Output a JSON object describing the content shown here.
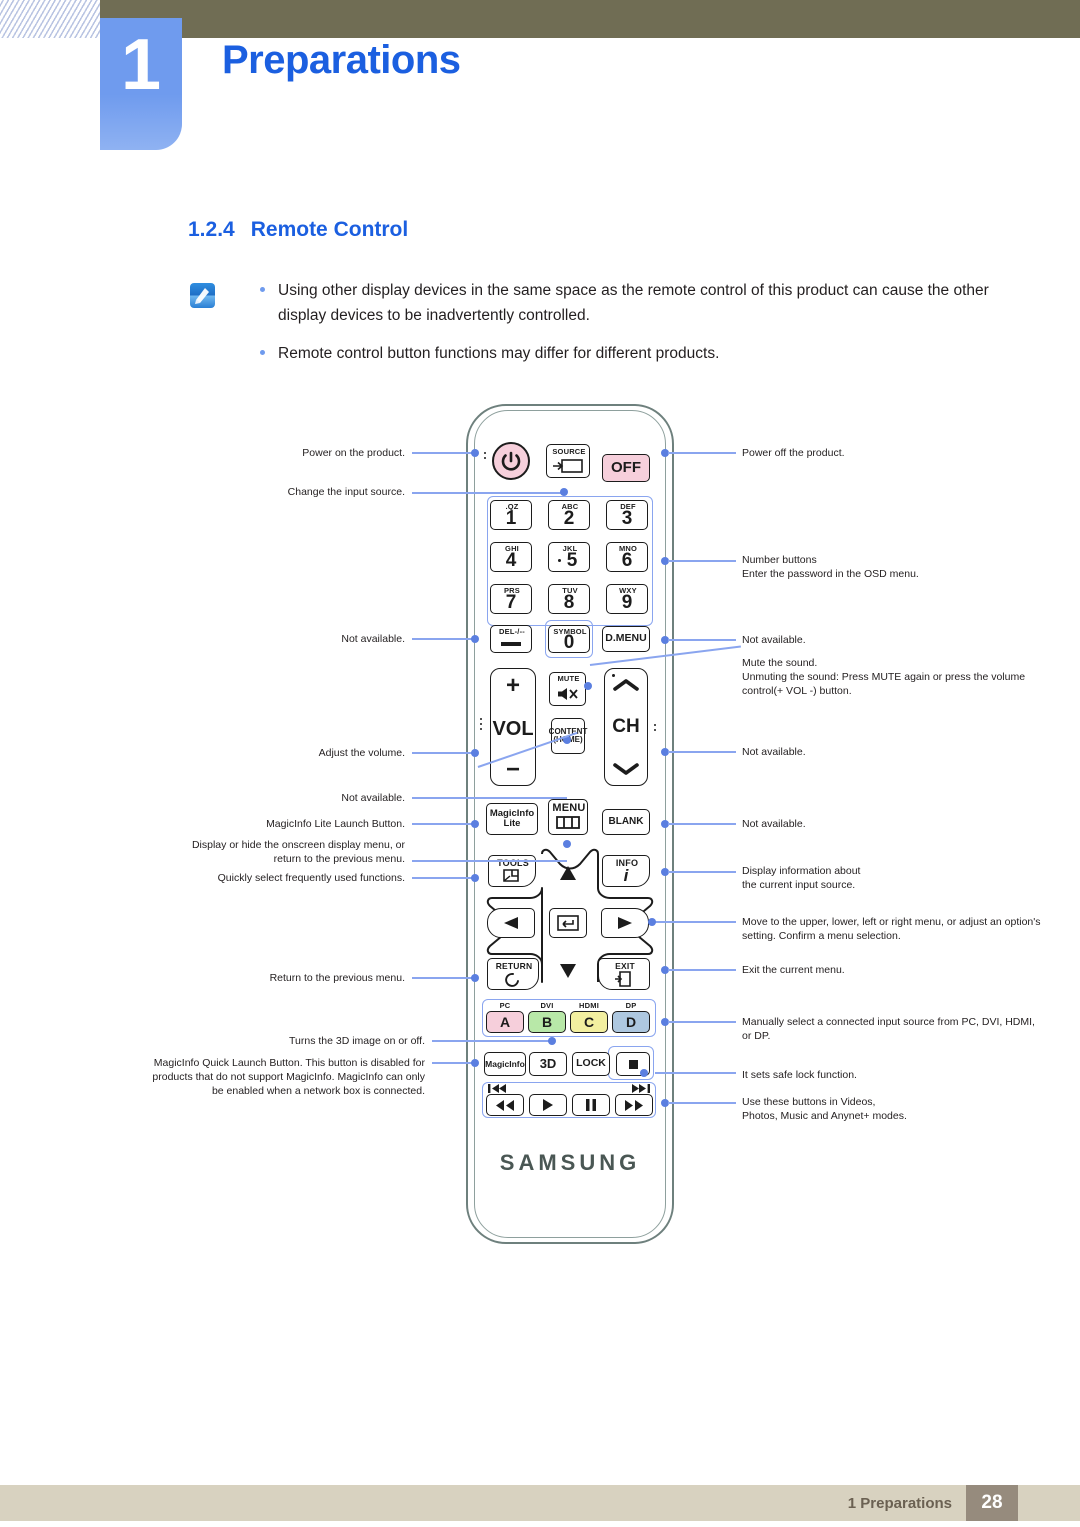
{
  "header": {
    "chapter_number": "1",
    "chapter_title": "Preparations"
  },
  "section": {
    "number": "1.2.4",
    "title": "Remote Control"
  },
  "notes": {
    "icon": "note-pencil-icon",
    "items": [
      "Using other display devices in the same space as the remote control of this product can cause the other display devices to be inadvertently controlled.",
      "Remote control button functions may differ for different products."
    ]
  },
  "remote": {
    "brand": "SAMSUNG",
    "buttons": {
      "power": "power-icon",
      "source_label": "SOURCE",
      "off": "OFF",
      "num1": "1",
      "num1_sub": ".QZ",
      "num2": "2",
      "num2_sub": "ABC",
      "num3": "3",
      "num3_sub": "DEF",
      "num4": "4",
      "num4_sub": "GHI",
      "num5": "5",
      "num5_sub": "JKL",
      "num6": "6",
      "num6_sub": "MNO",
      "num7": "7",
      "num7_sub": "PRS",
      "num8": "8",
      "num8_sub": "TUV",
      "num9": "9",
      "num9_sub": "WXY",
      "num0": "0",
      "num0_sub": "SYMBOL",
      "del_sub": "DEL-/--",
      "dmenu": "D.MENU",
      "vol": "VOL",
      "vol_plus": "+",
      "vol_minus": "−",
      "mute": "MUTE",
      "ch": "CH",
      "content_line1": "CONTENT",
      "content_line2": "(HOME)",
      "magicinfo_lite_line1": "MagicInfo",
      "magicinfo_lite_line2": "Lite",
      "menu": "MENU",
      "blank": "BLANK",
      "tools": "TOOLS",
      "info": "INFO",
      "return": "RETURN",
      "exit": "EXIT",
      "color_a": "A",
      "color_a_label": "PC",
      "color_b": "B",
      "color_b_label": "DVI",
      "color_c": "C",
      "color_c_label": "HDMI",
      "color_d": "D",
      "color_d_label": "DP",
      "magicinfo": "MagicInfo",
      "three_d": "3D",
      "lock": "LOCK",
      "stop": "stop-icon",
      "prev_track": "previous-track-icon",
      "next_track": "next-track-icon",
      "rewind": "rewind-icon",
      "play": "play-icon",
      "pause": "pause-icon",
      "fast_forward": "fast-forward-icon"
    }
  },
  "callouts": {
    "left": [
      {
        "id": "power-on",
        "text": "Power on the product."
      },
      {
        "id": "change-input-source",
        "text": "Change the input source."
      },
      {
        "id": "not-available-del",
        "text": "Not available."
      },
      {
        "id": "adjust-volume",
        "text": "Adjust the volume."
      },
      {
        "id": "not-available-content",
        "text": "Not available."
      },
      {
        "id": "magicinfo-lite-launch",
        "text": "MagicInfo Lite Launch Button."
      },
      {
        "id": "menu-display-hide",
        "text": "Display or hide the onscreen display menu, or return to the previous menu."
      },
      {
        "id": "tools-quick-select",
        "text": "Quickly select frequently used functions."
      },
      {
        "id": "return-previous-menu",
        "text": "Return to the previous menu."
      },
      {
        "id": "three-d-toggle",
        "text": "Turns the 3D image on or off."
      },
      {
        "id": "magicinfo-quick-launch",
        "text": "MagicInfo Quick Launch Button. This button is disabled for products that do not support MagicInfo. MagicInfo can only be enabled when a network box is connected."
      }
    ],
    "right": [
      {
        "id": "power-off",
        "text": "Power off the product."
      },
      {
        "id": "number-buttons",
        "text": "Number buttons\nEnter the password in the OSD menu."
      },
      {
        "id": "not-available-dmenu",
        "text": "Not available."
      },
      {
        "id": "mute-sound",
        "text": "Mute the sound.\nUnmuting the sound: Press MUTE again or press the volume control(+ VOL -) button."
      },
      {
        "id": "not-available-ch",
        "text": "Not available."
      },
      {
        "id": "not-available-blank",
        "text": "Not available."
      },
      {
        "id": "info-display",
        "text": "Display information about\nthe current input source."
      },
      {
        "id": "navigation-move",
        "text": "Move to the upper, lower, left or right menu, or adjust an option's setting. Confirm a menu selection."
      },
      {
        "id": "exit-current-menu",
        "text": "Exit the current menu."
      },
      {
        "id": "manual-input-select",
        "text": "Manually select a connected input source from PC, DVI, HDMI, or DP."
      },
      {
        "id": "safe-lock",
        "text": "It sets safe lock function."
      },
      {
        "id": "media-buttons",
        "text": "Use these buttons in Videos,\nPhotos, Music and Anynet+ modes."
      }
    ]
  },
  "footer": {
    "label": "1 Preparations",
    "page": "28"
  },
  "colors": {
    "accent_blue": "#1b5fe0",
    "tab_blue": "#6f9bee",
    "header_olive": "#706d54",
    "footer_beige": "#d8d2c0",
    "footer_page_bg": "#968b7d",
    "callout_blue": "#8aa5ef",
    "remote_outline": "#6e807d"
  }
}
